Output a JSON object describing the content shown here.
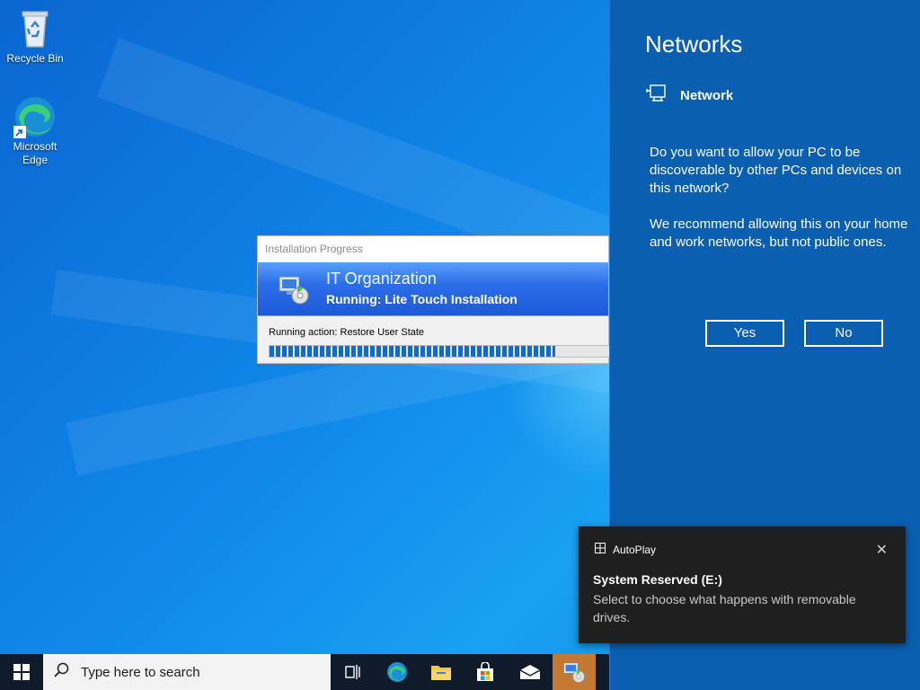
{
  "desktop": {
    "icons": [
      {
        "label": "Recycle Bin"
      },
      {
        "label": "Microsoft Edge"
      }
    ]
  },
  "installation_window": {
    "title": "Installation Progress",
    "organization": "IT Organization",
    "running_text": "Running: Lite Touch Installation",
    "action_text": "Running action: Restore User State",
    "progress_fraction": 0.84
  },
  "networks_panel": {
    "title": "Networks",
    "network_name": "Network",
    "question": "Do you want to allow your PC to be discoverable by other PCs and devices on this network?",
    "recommendation": "We recommend allowing this on your home and work networks, but not public ones.",
    "yes_label": "Yes",
    "no_label": "No"
  },
  "autoplay_toast": {
    "app_name": "AutoPlay",
    "drive_title": "System Reserved (E:)",
    "description": "Select to choose what happens with removable drives."
  },
  "taskbar": {
    "search_placeholder": "Type here to search",
    "items": [
      "task-view-icon",
      "edge-icon",
      "file-explorer-icon",
      "store-icon",
      "mail-icon",
      "deployment-icon"
    ],
    "active_item": "deployment-icon"
  },
  "colors": {
    "panel_bg": "#0a5fb0",
    "toast_bg": "#1f1f1f",
    "taskbar_bg": "#0f1a2b",
    "active_taskbar_item": "#c27a33"
  }
}
